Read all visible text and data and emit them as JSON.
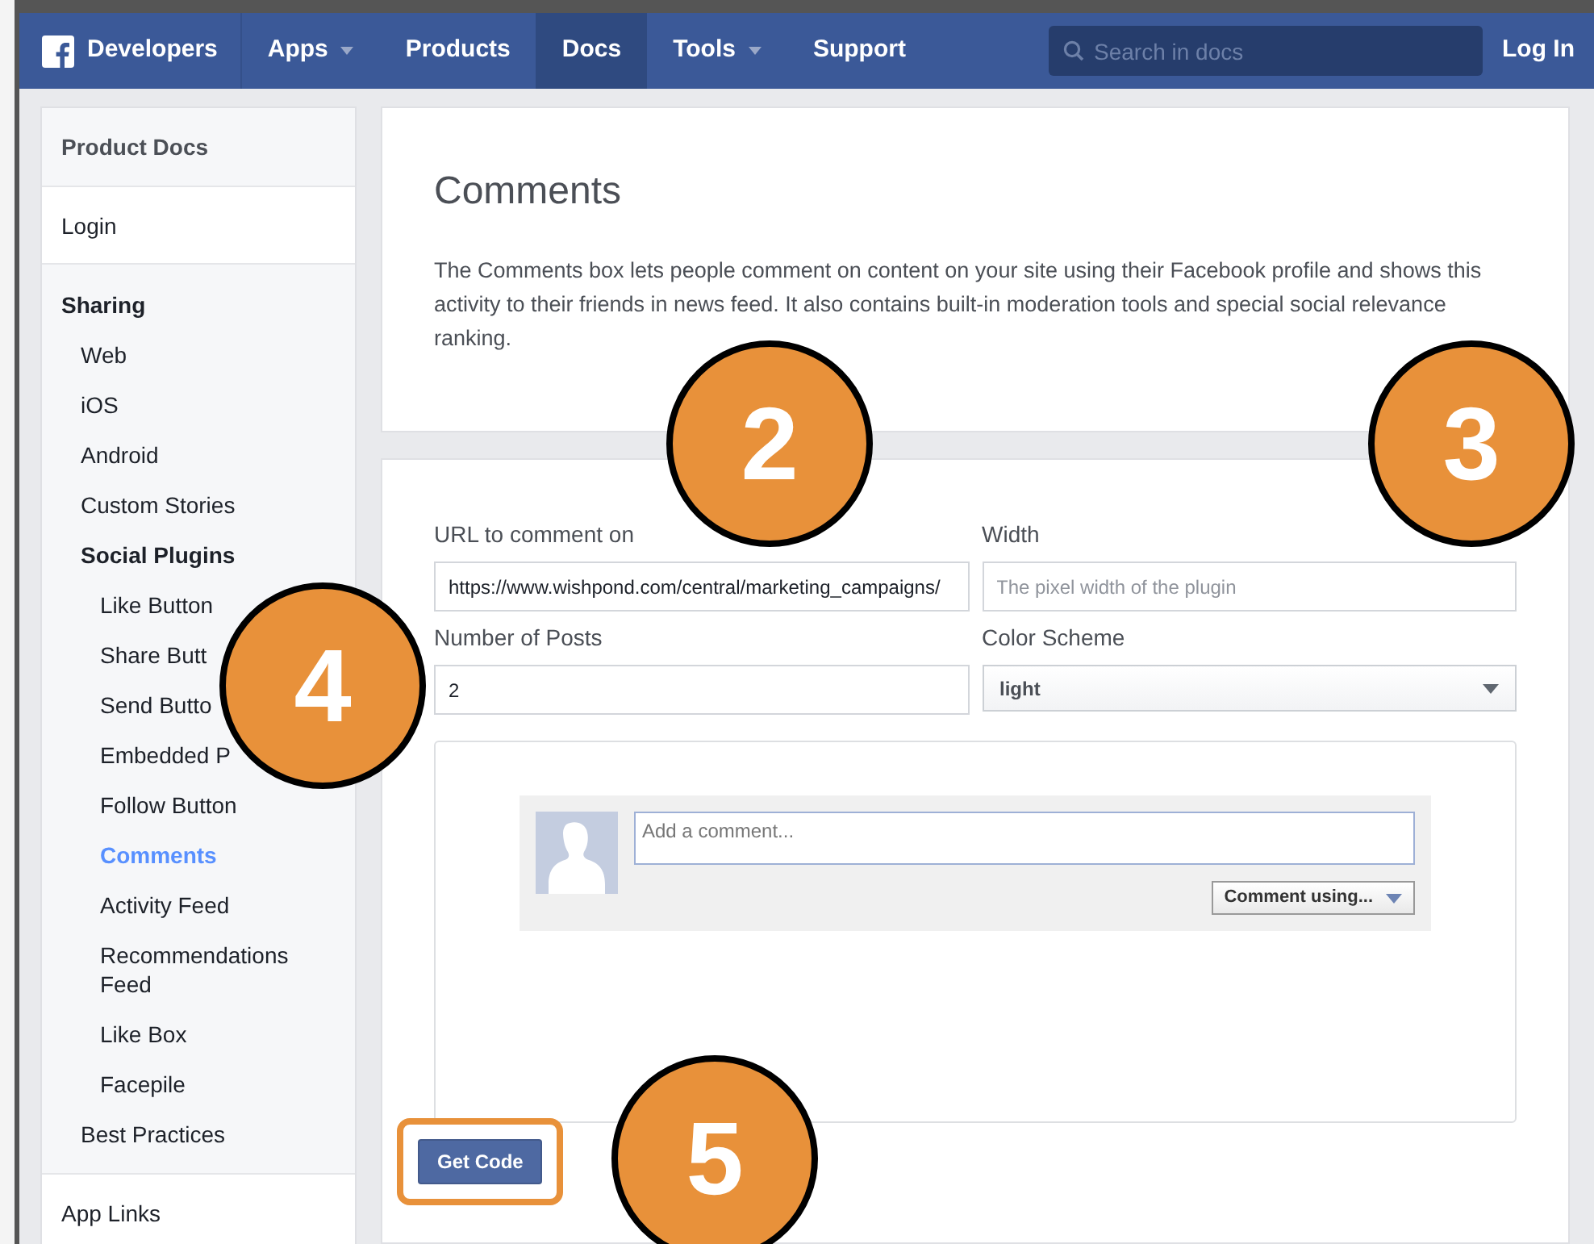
{
  "nav": {
    "brand": "Developers",
    "items": [
      {
        "label": "Apps",
        "dropdown": true,
        "selected": false
      },
      {
        "label": "Products",
        "dropdown": false,
        "selected": false
      },
      {
        "label": "Docs",
        "dropdown": false,
        "selected": true
      },
      {
        "label": "Tools",
        "dropdown": true,
        "selected": false
      },
      {
        "label": "Support",
        "dropdown": false,
        "selected": false
      }
    ],
    "search": {
      "placeholder": "Search in docs"
    },
    "login": "Log In"
  },
  "sidebar": {
    "header": "Product Docs",
    "sections": [
      {
        "label": "Login",
        "kind": "block",
        "selected": false
      },
      {
        "label": "Sharing",
        "kind": "group",
        "selected": false,
        "children": [
          {
            "label": "Web",
            "selected": false
          },
          {
            "label": "iOS",
            "selected": false
          },
          {
            "label": "Android",
            "selected": false
          },
          {
            "label": "Custom Stories",
            "selected": false
          },
          {
            "label": "Social Plugins",
            "selected": false,
            "children": [
              {
                "label": "Like Button",
                "selected": false
              },
              {
                "label": "Share Butt",
                "selected": false
              },
              {
                "label": "Send Butto",
                "selected": false
              },
              {
                "label": "Embedded P",
                "selected": false
              },
              {
                "label": "Follow Button",
                "selected": false
              },
              {
                "label": "Comments",
                "selected": true
              },
              {
                "label": "Activity Feed",
                "selected": false
              },
              {
                "label": "Recommendations Feed",
                "selected": false
              },
              {
                "label": "Like Box",
                "selected": false
              },
              {
                "label": "Facepile",
                "selected": false
              }
            ]
          },
          {
            "label": "Best Practices",
            "selected": false
          }
        ]
      },
      {
        "label": "App Links",
        "kind": "block",
        "selected": false
      }
    ]
  },
  "intro": {
    "title": "Comments",
    "description": "The Comments box lets people comment on content on your site using their Facebook profile and shows this activity to their friends in news feed. It also contains built-in moderation tools and special social relevance ranking."
  },
  "form": {
    "fields": [
      {
        "kind": "input",
        "label": "URL to comment on",
        "value": "https://www.wishpond.com/central/marketing_campaigns/"
      },
      {
        "kind": "input",
        "label": "Width",
        "placeholder": "The pixel width of the plugin"
      },
      {
        "kind": "input",
        "label": "Number of Posts",
        "value": "2"
      },
      {
        "kind": "select",
        "label": "Color Scheme",
        "value": "light"
      }
    ],
    "preview": {
      "comment_placeholder": "Add a comment...",
      "comment_using": "Comment using..."
    },
    "get_code": {
      "label": "Get Code",
      "highlighted": true
    }
  },
  "callouts": [
    {
      "number": "2"
    },
    {
      "number": "3"
    },
    {
      "number": "4"
    },
    {
      "number": "5"
    }
  ]
}
